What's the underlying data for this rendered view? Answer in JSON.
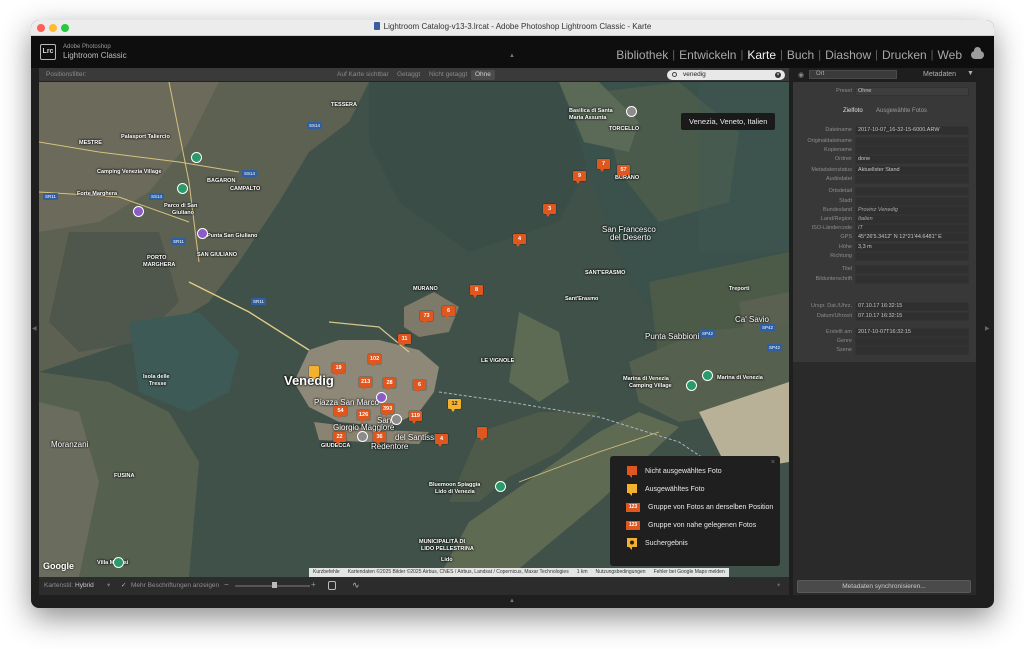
{
  "window": {
    "title": "Lightroom Catalog-v13-3.lrcat - Adobe Photoshop Lightroom Classic - Karte",
    "brand_small": "Adobe Photoshop",
    "brand_large": "Lightroom Classic",
    "logo_text": "Lrc",
    "traffic_colors": [
      "#ff5f57",
      "#febc2e",
      "#28c840"
    ]
  },
  "modules": [
    "Bibliothek",
    "Entwickeln",
    "Karte",
    "Buch",
    "Diashow",
    "Drucken",
    "Web"
  ],
  "active_module": "Karte",
  "filter": {
    "label": "Positionsfilter:",
    "buttons": [
      "Auf Karte sichtbar",
      "Getaggt",
      "Nicht getaggt",
      "Ohne"
    ],
    "active": "Ohne",
    "search_value": "venedig"
  },
  "map": {
    "tooltip": "Venezia, Veneto, Italien",
    "labels": {
      "venedig": "Venedig",
      "mestre": "MESTRE",
      "tessera": "TESSERA",
      "torcello": "TORCELLO",
      "burano": "BURANO",
      "basilica1": "Basilica di Santa",
      "basilica2": "Maria Assunta",
      "bagaron": "BAGARON",
      "campalto": "CAMPALTO",
      "palasport1": "Palasport Taliercio",
      "camping1": "Camping Venezia Village",
      "fortemar": "Forte Marghera",
      "parco1": "Parco di San",
      "parco2": "Giuliano",
      "puntasg": "Punta San Giuliano",
      "sangiul": "SAN GIULIANO",
      "porto1": "PORTO",
      "porto2": "MARGHERA",
      "sf1": "San Francesco",
      "sf2": "del Deserto",
      "santerasmo_caps": "SANT'ERASMO",
      "santerasmo": "Sant'Erasmo",
      "murano": "MURANO",
      "vignole": "LE VIGNOLE",
      "piazza": "Piazza San Marco",
      "sgm1": "San",
      "sgm2": "Giorgio Maggiore",
      "redentore1": "del Santissimo",
      "redentore2": "Redentore",
      "giudecca": "GIUDECCA",
      "isola1": "Isola delle",
      "isola2": "Tresse",
      "moranzani": "Moranzani",
      "fusina": "FUSINA",
      "puntasabb": "Punta Sabbioni",
      "trepalli": "Treporti",
      "cavallino": "Ca' Savio",
      "marina1": "Marina di Venezia",
      "marina2": "Camping Village",
      "marina3": "Marina di Venezia",
      "bluemoon1": "Bluemoon Spiaggia",
      "bluemoon2": "Lido di Venezia",
      "lido1": "MUNICIPALITÀ DI",
      "lido2": "LIDO PELLESTRINA",
      "lido3": "Lido",
      "villa": "Villa Maltesi"
    },
    "road_badges": [
      "SS14",
      "SS14",
      "SR11",
      "SS14",
      "SR11",
      "SR11",
      "SP42",
      "SP42",
      "SP42"
    ],
    "markers": [
      {
        "label": "7"
      },
      {
        "label": "57"
      },
      {
        "label": "9"
      },
      {
        "label": "3"
      },
      {
        "label": "4"
      },
      {
        "label": "8"
      },
      {
        "label": "73"
      },
      {
        "label": "6"
      },
      {
        "label": "11"
      },
      {
        "label": "102"
      },
      {
        "label": "19"
      },
      {
        "label": "213"
      },
      {
        "label": "28"
      },
      {
        "label": "6"
      },
      {
        "label": "393"
      },
      {
        "label": "54"
      },
      {
        "label": "126"
      },
      {
        "label": "119"
      },
      {
        "label": "22"
      },
      {
        "label": "36"
      },
      {
        "label": "4"
      },
      {
        "label": "12"
      },
      {
        "label": ""
      }
    ],
    "legend": [
      "Nicht ausgewähltes Foto",
      "Ausgewähltes Foto",
      "Gruppe von Fotos an derselben Position",
      "Gruppe von nahe gelegenen Fotos",
      "Suchergebnis"
    ],
    "legend_badge": "123",
    "attribution": [
      "Kurzbefehle",
      "Kartendaten ©2025 Bilder ©2025 Airbus, CNES / Airbus, Landsat / Copernicus, Maxar Technologies",
      "1 km",
      "Nutzungsbedingungen",
      "Fehler bei Google Maps melden"
    ],
    "google": "Google"
  },
  "bottombar": {
    "style_label": "Kartenstil:",
    "style_value": "Hybrid",
    "captions_label": "Mehr Beschriftungen anzeigen"
  },
  "right_panel": {
    "header_left": "Ort",
    "header_title": "Metadaten",
    "preset_label": "Preset",
    "preset_value": "Ohne",
    "tabs": [
      "Zielfoto",
      "Ausgewählte Fotos"
    ],
    "fields": [
      {
        "k": "Dateiname",
        "v": "2017-10-07_16-32-15-6000.ARW"
      },
      {
        "k": "Originaldateiname",
        "v": ""
      },
      {
        "k": "Kopiename",
        "v": ""
      },
      {
        "k": "Ordner",
        "v": "done"
      },
      {
        "k": "Metadatenstatus",
        "v": "Aktuellster Stand"
      },
      {
        "k": "Audiodatei",
        "v": ""
      },
      {
        "k": "Ortsdetail",
        "v": ""
      },
      {
        "k": "Stadt",
        "v": ""
      },
      {
        "k": "Bundesland",
        "v": "Provinz Venedig"
      },
      {
        "k": "Land/Region",
        "v": "Italien"
      },
      {
        "k": "ISO-Ländercode",
        "v": "IT"
      },
      {
        "k": "GPS",
        "v": "45°26'5.3412\" N 12°21'44.6481\" E"
      },
      {
        "k": "Höhe",
        "v": "3,3 m"
      },
      {
        "k": "Richtung",
        "v": ""
      },
      {
        "k": "Titel",
        "v": ""
      },
      {
        "k": "Bildunterschrift",
        "v": ""
      },
      {
        "k": "Urspr. Dat./Uhrz.",
        "v": "07.10.17 16:32:15"
      },
      {
        "k": "Datum/Uhrzeit",
        "v": "07.10.17 16:32:15"
      },
      {
        "k": "Erstellt am",
        "v": "2017-10-07T16:32:15"
      },
      {
        "k": "Genre",
        "v": ""
      },
      {
        "k": "Szene",
        "v": ""
      }
    ],
    "sync_button": "Metadaten synchronisieren..."
  }
}
